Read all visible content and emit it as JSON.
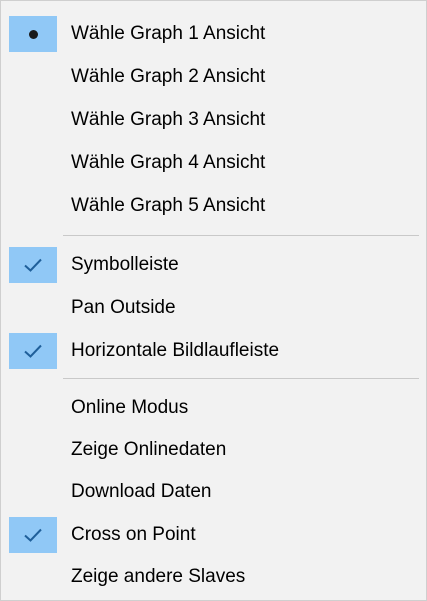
{
  "menu": {
    "groups": [
      {
        "items": [
          {
            "label": "Wähle Graph 1 Ansicht",
            "state": "radio-selected"
          },
          {
            "label": "Wähle Graph 2 Ansicht",
            "state": "none"
          },
          {
            "label": "Wähle Graph 3 Ansicht",
            "state": "none"
          },
          {
            "label": "Wähle Graph 4 Ansicht",
            "state": "none"
          },
          {
            "label": "Wähle Graph 5 Ansicht",
            "state": "none"
          }
        ]
      },
      {
        "items": [
          {
            "label": "Symbolleiste",
            "state": "checked"
          },
          {
            "label": "Pan Outside",
            "state": "none"
          },
          {
            "label": "Horizontale Bildlaufleiste",
            "state": "checked"
          }
        ]
      },
      {
        "items": [
          {
            "label": "Online Modus",
            "state": "none"
          },
          {
            "label": "Zeige Onlinedaten",
            "state": "none"
          },
          {
            "label": "Download Daten",
            "state": "none"
          },
          {
            "label": "Cross on Point",
            "state": "checked"
          },
          {
            "label": "Zeige andere Slaves",
            "state": "none"
          }
        ]
      }
    ]
  },
  "colors": {
    "background": "#f2f2f2",
    "highlight": "#90c8f6",
    "separator": "#c9c9c9",
    "check": "#1f5f9a"
  },
  "icons": {
    "radio": "radio-dot-icon",
    "check": "checkmark-icon"
  }
}
